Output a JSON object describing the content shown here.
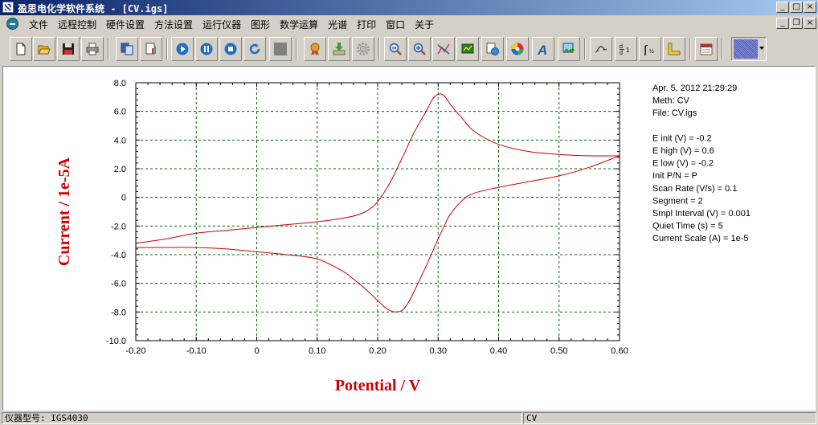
{
  "window": {
    "title": "盈思电化学软件系统 - [CV.igs]",
    "controls": [
      "_",
      "□",
      "×"
    ]
  },
  "menu": {
    "items": [
      "文件",
      "远程控制",
      "硬件设置",
      "方法设置",
      "运行仪器",
      "图形",
      "数学运算",
      "光谱",
      "打印",
      "窗口",
      "关于"
    ],
    "mdi_controls": [
      "_",
      "❐",
      "×"
    ]
  },
  "toolbar": {
    "icons": [
      "new-file-icon",
      "open-folder-icon",
      "save-disk-icon",
      "print-icon",
      "copy-window-icon",
      "report-icon",
      "run-play-icon",
      "pause-icon",
      "stop-icon",
      "refresh-icon",
      "blank-gray-icon",
      "ribbon-award-icon",
      "basket-download-icon",
      "gear-icon",
      "zoom-out-icon",
      "zoom-in-icon",
      "graph-tools-icon",
      "monitor-chart-icon",
      "overlay-icon",
      "color-wheel-icon",
      "text-font-icon",
      "image-export-icon",
      "smooth-curve-icon",
      "derivative-icon",
      "integral-icon",
      "ruler-icon",
      "calendar-icon",
      "pattern-select-icon"
    ],
    "accent": "#1e6ec8"
  },
  "info": {
    "lines": [
      "Apr. 5, 2012   21:29:29",
      "Meth: CV",
      "File: CV.igs",
      "",
      "E init (V) = -0.2",
      "E high (V) = 0.6",
      "E low (V) = -0.2",
      "Init P/N = P",
      "Scan Rate (V/s) = 0.1",
      "Segment = 2",
      "Smpl Interval (V) = 0.001",
      "Quiet Time (s) = 5",
      "Current Scale (A) = 1e-5"
    ]
  },
  "status": {
    "instrument": "仪器型号: IGS4030",
    "method": "CV"
  },
  "chart_data": {
    "type": "line",
    "xlabel": "Potential / V",
    "ylabel": "Current / 1e-5A",
    "xlim": [
      -0.2,
      0.6
    ],
    "ylim": [
      -10.0,
      8.0
    ],
    "x_ticks": [
      "-0.20",
      "-0.10",
      "0",
      "0.10",
      "0.20",
      "0.30",
      "0.40",
      "0.50",
      "0.60"
    ],
    "y_ticks": [
      "8.0",
      "6.0",
      "4.0",
      "2.0",
      "0",
      "-2.0",
      "-4.0",
      "-6.0",
      "-8.0",
      "-10.0"
    ],
    "grid": true,
    "line_color": "#cc0000",
    "grid_color": "#006400",
    "series": [
      {
        "x": [
          -0.2,
          -0.15,
          -0.1,
          -0.05,
          0.0,
          0.05,
          0.1,
          0.15,
          0.18,
          0.2,
          0.22,
          0.24,
          0.26,
          0.28,
          0.29,
          0.3,
          0.31,
          0.32,
          0.34,
          0.36,
          0.4,
          0.45,
          0.5,
          0.55,
          0.6
        ],
        "y": [
          -3.2,
          -2.9,
          -2.5,
          -2.3,
          -2.1,
          -1.9,
          -1.7,
          -1.4,
          -1.0,
          -0.3,
          1.0,
          2.7,
          4.5,
          6.0,
          6.8,
          7.2,
          7.1,
          6.5,
          5.5,
          4.6,
          3.7,
          3.2,
          3.0,
          2.9,
          2.9
        ]
      },
      {
        "x": [
          0.6,
          0.55,
          0.5,
          0.45,
          0.4,
          0.36,
          0.34,
          0.32,
          0.31,
          0.3,
          0.28,
          0.26,
          0.25,
          0.24,
          0.23,
          0.22,
          0.21,
          0.2,
          0.18,
          0.16,
          0.14,
          0.1,
          0.05,
          0.0,
          -0.05,
          -0.1,
          -0.15,
          -0.2
        ],
        "y": [
          2.9,
          2.1,
          1.5,
          1.1,
          0.7,
          0.3,
          -0.2,
          -1.2,
          -2.0,
          -2.9,
          -4.8,
          -6.6,
          -7.4,
          -7.9,
          -8.0,
          -7.9,
          -7.6,
          -7.2,
          -6.4,
          -5.7,
          -5.1,
          -4.3,
          -4.0,
          -3.8,
          -3.6,
          -3.5,
          -3.5,
          -3.5
        ]
      }
    ]
  }
}
